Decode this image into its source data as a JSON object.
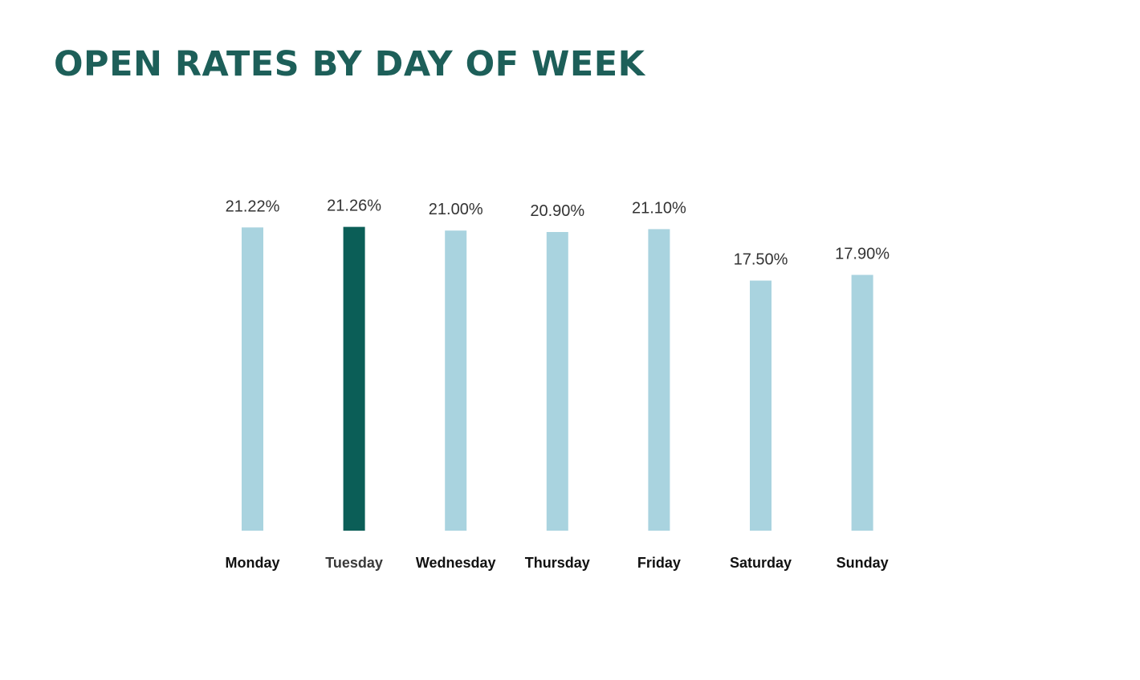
{
  "title": "OPEN RATES BY DAY OF WEEK",
  "chart_data": {
    "type": "bar",
    "title": "OPEN RATES BY DAY OF WEEK",
    "xlabel": "",
    "ylabel": "",
    "categories": [
      "Monday",
      "Tuesday",
      "Wednesday",
      "Thursday",
      "Friday",
      "Saturday",
      "Sunday"
    ],
    "values": [
      21.22,
      21.26,
      21.0,
      20.9,
      21.1,
      17.5,
      17.9
    ],
    "value_labels": [
      "21.22%",
      "21.26%",
      "21.00%",
      "20.90%",
      "21.10%",
      "17.50%",
      "17.90%"
    ],
    "ylim": [
      0,
      21.26
    ],
    "grid": false,
    "legend": "none",
    "highlight_index": 1,
    "colors": {
      "default": "#a9d3df",
      "highlight": "#0b5e57"
    }
  }
}
